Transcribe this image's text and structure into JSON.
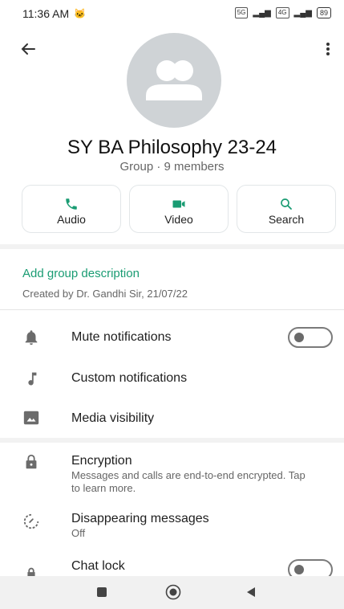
{
  "status_bar": {
    "time": "11:36 AM",
    "time_icon": "🐱",
    "sim1": "5G",
    "sim2": "4G",
    "battery": "89"
  },
  "group": {
    "name": "SY BA Philosophy 23-24",
    "meta": "Group · 9 members"
  },
  "actions": [
    {
      "label": "Audio",
      "icon": "phone-icon"
    },
    {
      "label": "Video",
      "icon": "video-icon"
    },
    {
      "label": "Search",
      "icon": "search-icon"
    }
  ],
  "description": {
    "link": "Add group description",
    "created_by": "Created by Dr. Gandhi Sir, 21/07/22"
  },
  "settings": [
    {
      "label": "Mute notifications",
      "icon": "bell-icon",
      "toggle": false
    },
    {
      "label": "Custom notifications",
      "icon": "music-note-icon"
    },
    {
      "label": "Media visibility",
      "icon": "image-icon"
    }
  ],
  "privacy": [
    {
      "label": "Encryption",
      "sub": "Messages and calls are end-to-end encrypted. Tap to learn more.",
      "icon": "lock-icon"
    },
    {
      "label": "Disappearing messages",
      "sub": "Off",
      "icon": "timer-icon"
    },
    {
      "label": "Chat lock",
      "icon": "chat-lock-icon",
      "toggle": false
    }
  ],
  "colors": {
    "accent": "#1a9c73",
    "avatar_bg": "#cfd3d6",
    "nav_bg": "#f1f1f1"
  }
}
